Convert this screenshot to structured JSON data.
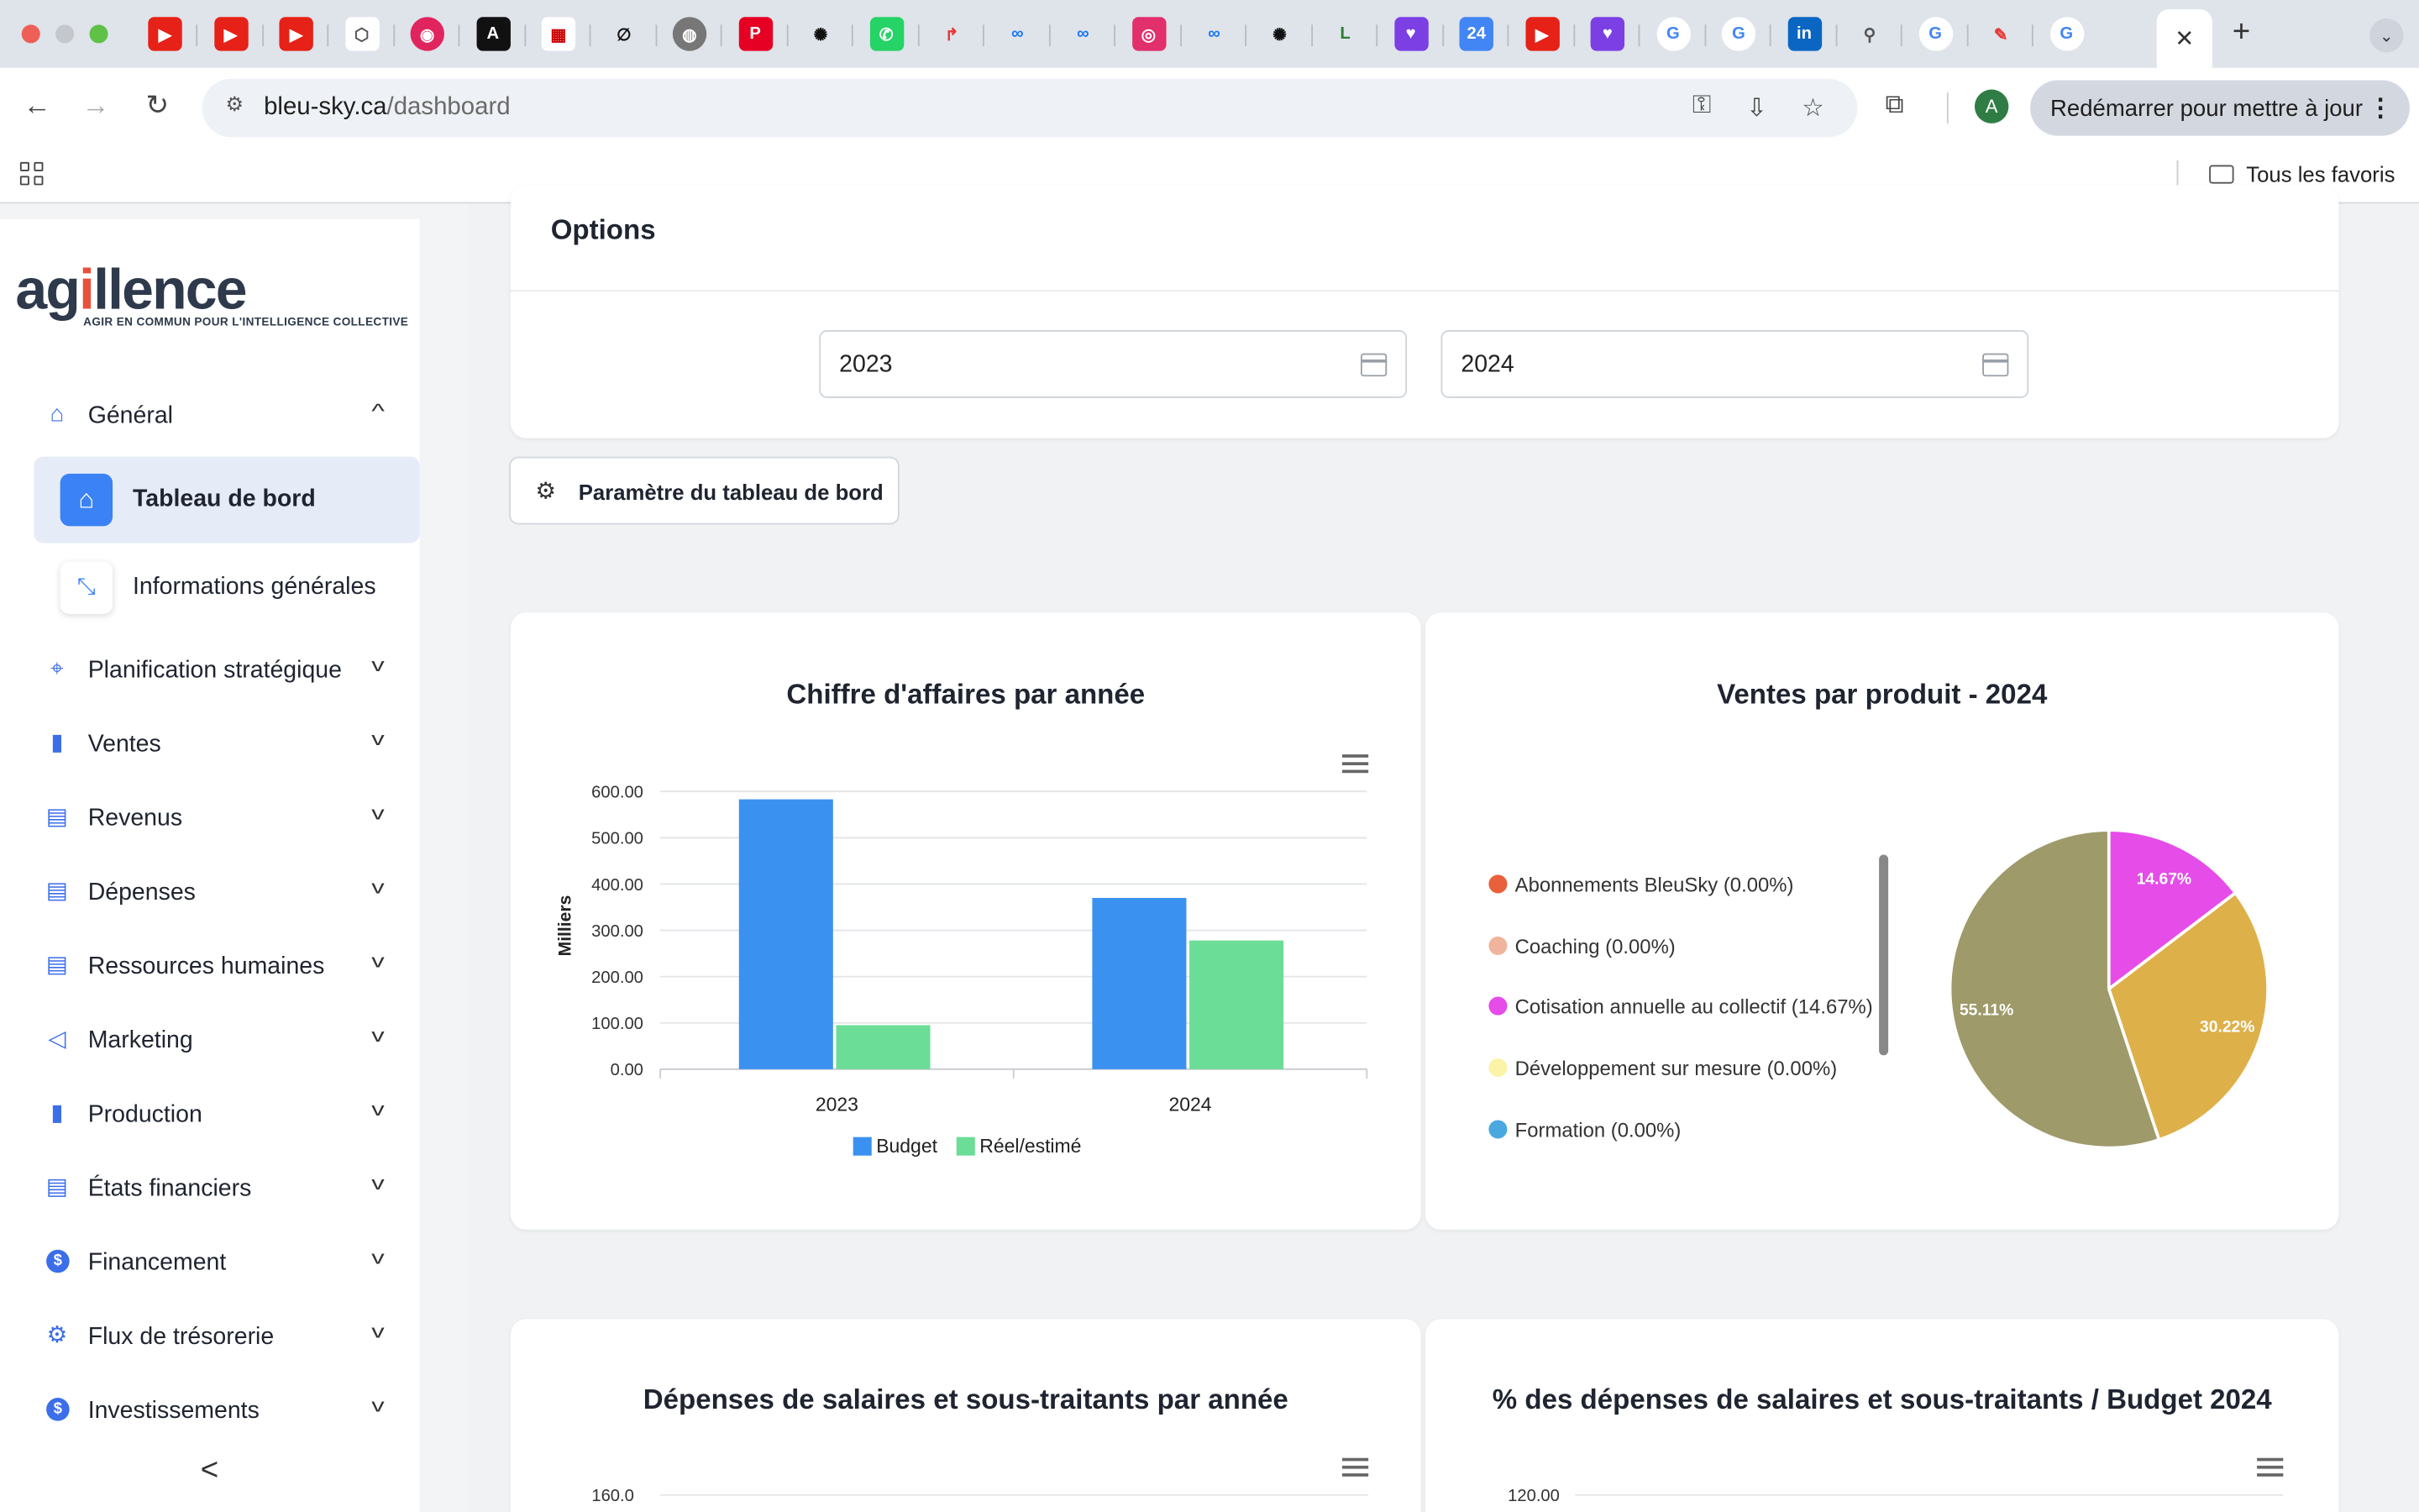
{
  "browser": {
    "url_domain": "bleu-sky.ca",
    "url_path": "/dashboard",
    "update_label": "Redémarrer pour mettre à jour",
    "profile_initial": "A",
    "bookmarks_label": "Tous les favoris",
    "tabs": [
      "youtube-icon",
      "youtube-icon",
      "youtube-icon",
      "app-icon",
      "opera-icon",
      "anthropic-icon",
      "qr-icon",
      "perplexity-icon",
      "globe-icon",
      "pinterest-icon",
      "chatgpt-icon",
      "whatsapp-icon",
      "red-arrow-icon",
      "meta-icon",
      "meta-icon",
      "instagram-icon",
      "meta-icon",
      "chatgpt-icon",
      "l-icon",
      "heart-icon",
      "calendar-icon",
      "youtube-icon",
      "heart-icon",
      "google-icon",
      "google-icon",
      "linkedin-icon",
      "link-icon",
      "google-icon",
      "app2-icon",
      "google-icon",
      "active-tab"
    ]
  },
  "sidebar": {
    "logo_word": "agillence",
    "logo_tagline": "AGIR EN COMMUN POUR L'INTELLIGENCE COLLECTIVE",
    "general": {
      "label": "Général",
      "icon": "home-icon"
    },
    "active_sub": {
      "label": "Tableau de bord",
      "icon": "home-icon"
    },
    "info_sub": {
      "label": "Informations générales",
      "icon": "compress-icon"
    },
    "items": [
      {
        "label": "Planification stratégique",
        "icon": "target-icon"
      },
      {
        "label": "Ventes",
        "icon": "book-icon"
      },
      {
        "label": "Revenus",
        "icon": "building-icon"
      },
      {
        "label": "Dépenses",
        "icon": "building-icon"
      },
      {
        "label": "Ressources humaines",
        "icon": "building-icon"
      },
      {
        "label": "Marketing",
        "icon": "megaphone-icon"
      },
      {
        "label": "Production",
        "icon": "book-icon"
      },
      {
        "label": "États financiers",
        "icon": "building-icon"
      },
      {
        "label": "Financement",
        "icon": "dollar-icon"
      },
      {
        "label": "Flux de trésorerie",
        "icon": "gear-icon"
      },
      {
        "label": "Investissements",
        "icon": "dollar-icon"
      }
    ]
  },
  "options": {
    "title": "Options",
    "date_from": "2023",
    "date_to": "2024",
    "settings_button": "Paramètre du tableau de bord"
  },
  "colors": {
    "accent": "#3b82f6",
    "budget": "#3b91f0",
    "reel": "#6bdd97"
  },
  "chart_data": [
    {
      "type": "bar",
      "title": "Chiffre d'affaires par année",
      "ylabel": "Milliers",
      "categories": [
        "2023",
        "2024"
      ],
      "series": [
        {
          "name": "Budget",
          "values": [
            583,
            370
          ],
          "color": "#3b91f0"
        },
        {
          "name": "Réel/estimé",
          "values": [
            95,
            278
          ],
          "color": "#6bdd97"
        }
      ],
      "yticks": [
        "0.00",
        "100.00",
        "200.00",
        "300.00",
        "400.00",
        "500.00",
        "600.00"
      ],
      "ylim": [
        0,
        600
      ]
    },
    {
      "type": "pie",
      "title": "Ventes par produit - 2024",
      "legend": [
        {
          "label": "Abonnements BleuSky (0.00%)",
          "color": "#e8603c"
        },
        {
          "label": "Coaching (0.00%)",
          "color": "#f0b49c"
        },
        {
          "label": "Cotisation annuelle au collectif (14.67%)",
          "color": "#e54ce8"
        },
        {
          "label": "Développement sur mesure (0.00%)",
          "color": "#fbf3a8"
        },
        {
          "label": "Formation (0.00%)",
          "color": "#4aa8e0"
        }
      ],
      "slices": [
        {
          "label": "14.67%",
          "value": 14.67,
          "color": "#e54ce8"
        },
        {
          "label": "30.22%",
          "value": 30.22,
          "color": "#deb04a"
        },
        {
          "label": "55.11%",
          "value": 55.11,
          "color": "#9e9a6a"
        }
      ]
    },
    {
      "type": "bar",
      "title": "Dépenses de salaires et sous-traitants par année",
      "yticks": [
        "160.0"
      ]
    },
    {
      "type": "bar",
      "title": "% des dépenses de salaires et sous-traitants / Budget 2024",
      "yticks": [
        "120.00"
      ]
    }
  ]
}
